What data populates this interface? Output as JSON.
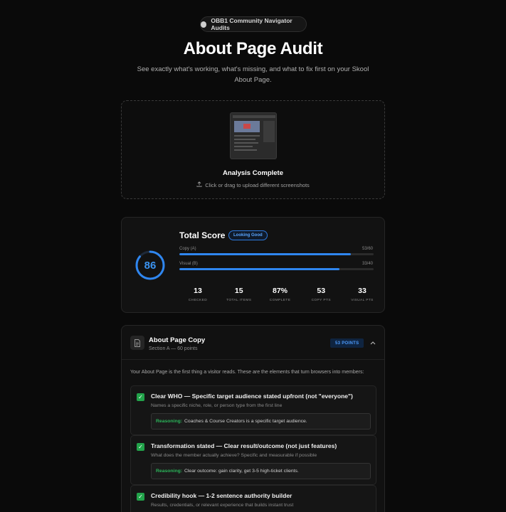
{
  "header": {
    "badge": "OBB1 Community Navigator Audits",
    "title": "About Page Audit",
    "subtitle": "See exactly what's working, what's missing, and what to fix first on your Skool About Page."
  },
  "upload": {
    "status": "Analysis Complete",
    "hint": "Click or drag to upload different screenshots"
  },
  "score": {
    "label": "Total Score",
    "status": "Looking Good",
    "value": "86",
    "fraction": 0.86,
    "ring_color": "#2f86ef",
    "bars": [
      {
        "label": "Copy (A)",
        "value": "53/60",
        "fraction": 0.883
      },
      {
        "label": "Visual (B)",
        "value": "33/40",
        "fraction": 0.825
      }
    ],
    "stats": [
      {
        "num": "13",
        "label": "CHECKED"
      },
      {
        "num": "15",
        "label": "TOTAL ITEMS"
      },
      {
        "num": "87%",
        "label": "COMPLETE"
      },
      {
        "num": "53",
        "label": "COPY PTS"
      },
      {
        "num": "33",
        "label": "VISUAL PTS"
      }
    ]
  },
  "section": {
    "title": "About Page Copy",
    "subtitle": "Section A — 60 points",
    "points": "53 POINTS",
    "intro": "Your About Page is the first thing a visitor reads. These are the elements that turn browsers into members:",
    "reason_label": "Reasoning:",
    "items": [
      {
        "title": "Clear WHO — Specific target audience stated upfront (not \"everyone\")",
        "desc": "Names a specific niche, role, or person type from the first line",
        "reason": "Coaches & Course Creators is a specific target audience."
      },
      {
        "title": "Transformation stated — Clear result/outcome (not just features)",
        "desc": "What does the member actually achieve? Specific and measurable if possible",
        "reason": "Clear outcome: gain clarity, get 3-5 high-ticket clients."
      },
      {
        "title": "Credibility hook — 1-2 sentence authority builder",
        "desc": "Results, credentials, or relevant experience that builds instant trust",
        "reason": ""
      }
    ]
  }
}
